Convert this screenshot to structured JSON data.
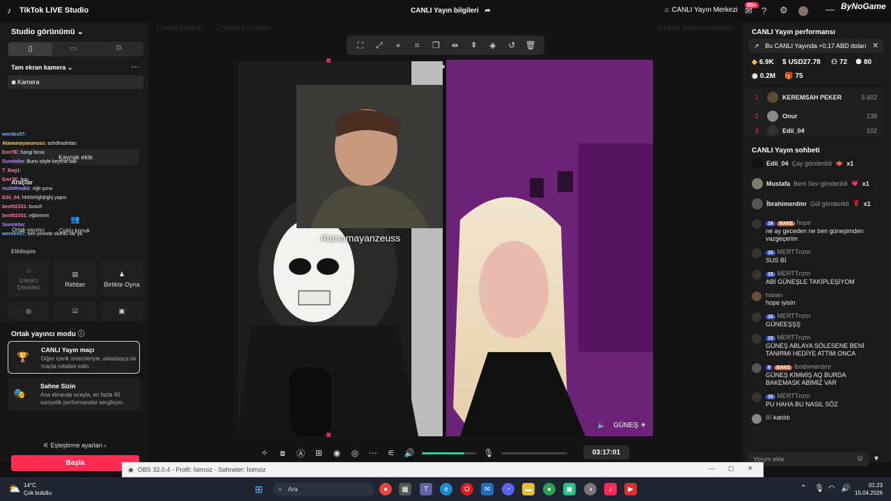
{
  "titlebar": {
    "app_name": "TikTok LIVE Studio",
    "center_title": "CANLI Yayın bilgileri",
    "live_center": "CANLI Yayın Merkezi",
    "notif_badge": "99+",
    "logo_text": "ByNoGame"
  },
  "left": {
    "studio_view": "Studio görünümü",
    "fullscreen_camera": "Tam ekran kamera",
    "camera_source": "Kamera",
    "add_source": "Kaynak ekle",
    "tools_heading": "Araçlar",
    "cohost": "Ortak yayıncı",
    "multi_guest": "Çoklu konuk",
    "interaction_heading": "Etkileşim",
    "tiles": [
      {
        "label": "İzleyici Dilekleri"
      },
      {
        "label": "Rehber"
      },
      {
        "label": "Birlikte Oyna"
      }
    ],
    "cohost_mode": "Ortak yayıncı modu",
    "modes": [
      {
        "title": "CANLI Yayın maçı",
        "desc": "Diğer içerik üreticileriyle, arkadaşça bir maçta rekabet edin."
      },
      {
        "title": "Sahne Sizin",
        "desc": "Ana ekranda sırayla, en fazla 90 saniyelik performanslar sergileyin."
      }
    ],
    "match_settings": "Eşleştirme ayarları",
    "start_button": "Başla",
    "overlay_chat": [
      {
        "user": "wordex57:",
        "text": ""
      },
      {
        "user": "Atanamayanzeuss:",
        "text": "ashdhashdas"
      },
      {
        "user": "Emr7E:",
        "text": "hangi bosa"
      },
      {
        "user": "Suesteba:",
        "text": "Bunu söyle keyfine bak"
      },
      {
        "user": "T_Bag1:",
        "text": ""
      },
      {
        "user": "Emr7E:",
        "text": "bos"
      },
      {
        "user": "muhittinakb:",
        "text": "eğit şunu"
      },
      {
        "user": "Edii_04:",
        "text": "hhhhhhjjhjhjjhj yapın"
      },
      {
        "user": "besttt2331:",
        "text": "bosch"
      },
      {
        "user": "besttt2331:",
        "text": "eğitirimm"
      },
      {
        "user": "Suesteba:",
        "text": ""
      },
      {
        "user": "wordex57:",
        "text": "sen yerinde olurdu var ya"
      }
    ]
  },
  "stage": {
    "faded_tabs": [
      "Saatlik Sıralama",
      "Sohbet & Görüşme",
      "CANLI Yayınınıza neşe katın"
    ],
    "overlay_name": "Atanamayanzeuss",
    "guest_label": "GÜNEŞ",
    "timer": "03:17:01",
    "volume_pct": 0.78
  },
  "right": {
    "perf_heading": "CANLI Yayın performansı",
    "earn_banner": "Bu CANLI Yayında +0.17 ABD doları",
    "stats": {
      "likes": "6.9K",
      "usd": "USD27.78",
      "viewers": "72",
      "followers": "80",
      "views": "0.2M",
      "gifts": "75"
    },
    "ranking": [
      {
        "rank": "1",
        "name": "KEREMSAH PEKER",
        "score": "5.602"
      },
      {
        "rank": "2",
        "name": "Onur",
        "score": "138"
      },
      {
        "rank": "3",
        "name": "Edii_04",
        "score": "102"
      }
    ],
    "chat_heading": "CANLI Yayın sohbeti",
    "gifts": [
      {
        "user": "Edii_04",
        "text": "Çay gönderildi",
        "count": "x1"
      },
      {
        "user": "Mustafa",
        "text": "Beni Sev gönderildi",
        "count": "x1"
      },
      {
        "user": "İbrahimerdmr",
        "text": "Gül gönderildi",
        "count": "x1"
      }
    ],
    "messages": [
      {
        "level": "16",
        "tag": "BAKE",
        "user": "hope",
        "text": "ne ay geceden ne ben güneşimden vazgeçerim"
      },
      {
        "level": "15",
        "tag": "",
        "user": "MERTTnzm",
        "text": "SUS Bİ"
      },
      {
        "level": "15",
        "tag": "",
        "user": "MERTTnzm",
        "text": "ABİ GÜNEŞLE TAKİPLEŞİYOM"
      },
      {
        "level": "",
        "tag": "",
        "user": "hasan",
        "text": "hope iyisin"
      },
      {
        "level": "15",
        "tag": "",
        "user": "MERTTnzm",
        "text": "GÜNEEŞŞŞ"
      },
      {
        "level": "15",
        "tag": "",
        "user": "MERTTnzm",
        "text": "GÜNEŞ ABLAYA SÖLESENE BENİ TANIRMI HEDİYE ATTIM ONCA"
      },
      {
        "level": "9",
        "tag": "BAKE",
        "user": "İbrahimerdmr",
        "text": "GÜNEŞ KİMMİŞ AQ BURDA BAKEMASK ABİMİZ VAR"
      },
      {
        "level": "15",
        "tag": "",
        "user": "MERTTnzm",
        "text": "PU HAHA BU NASIL SÖZ"
      }
    ],
    "joined_user": "Bİ",
    "joined_text": "katıldı",
    "comment_placeholder": "Yorum ekle"
  },
  "obs": {
    "title": "OBS 32.0.4 - Profil: İsimsiz - Sahneler: İsimsiz"
  },
  "taskbar": {
    "weather_temp": "14°C",
    "weather_desc": "Çok bulutlu",
    "search_placeholder": "Ara",
    "time": "01:23",
    "date": "15.04.2026"
  }
}
